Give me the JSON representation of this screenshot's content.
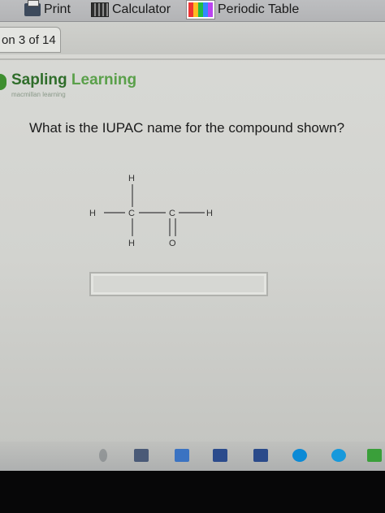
{
  "toolbar": {
    "print_label": "Print",
    "calculator_label": "Calculator",
    "periodic_label": "Periodic Table"
  },
  "tab": {
    "label": "on 3 of 14"
  },
  "brand": {
    "name_part1": "Sapling",
    "name_part2": "Learning",
    "subtitle": "macmillan learning"
  },
  "question": {
    "text": "What is the IUPAC name for the compound shown?"
  },
  "molecule": {
    "atoms": {
      "h_top": "H",
      "h_left": "H",
      "c1": "C",
      "c2": "C",
      "h_right": "H",
      "h_bottom": "H",
      "o": "O"
    }
  },
  "answer": {
    "value": "",
    "placeholder": ""
  },
  "icons": {
    "print": "printer-icon",
    "calculator": "calculator-icon",
    "periodic": "periodic-table-icon"
  },
  "colors": {
    "brand_dark": "#2f6d2a",
    "brand_light": "#5aa04a"
  }
}
